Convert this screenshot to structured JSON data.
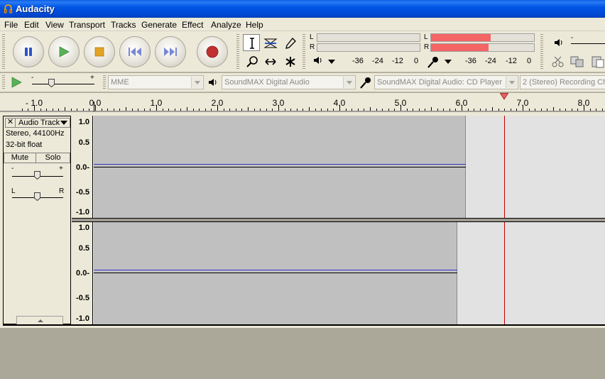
{
  "window": {
    "title": "Audacity"
  },
  "menu": [
    "File",
    "Edit",
    "View",
    "Transport",
    "Tracks",
    "Generate",
    "Effect",
    "Analyze",
    "Help"
  ],
  "meters": {
    "play_lr": [
      "L",
      "R"
    ],
    "scale_left": [
      "-36",
      "-24",
      "-12",
      "0"
    ],
    "scale_right": [
      "-36",
      "-24",
      "-12",
      "0"
    ],
    "record_level_L": 0.58,
    "record_level_R": 0.56
  },
  "device": {
    "host": "MME",
    "output": "SoundMAX Digital Audio",
    "input": "SoundMAX Digital Audio: CD Player",
    "channels": "2 (Stereo) Recording Ch"
  },
  "ruler": {
    "labels": [
      "- 1.0",
      "0.0",
      "1.0",
      "2.0",
      "3.0",
      "4.0",
      "5.0",
      "6.0",
      "7.0",
      "8.0"
    ]
  },
  "track": {
    "name": "Audio Track",
    "close_symbol": "✕",
    "format": "Stereo, 44100Hz",
    "bits": "32-bit float",
    "mute": "Mute",
    "solo": "Solo",
    "gain_minus": "-",
    "gain_plus": "+",
    "pan_left": "L",
    "pan_right": "R",
    "scale": [
      "1.0",
      "0.5",
      "0.0-",
      "-0.5",
      "-1.0"
    ]
  },
  "colors": {
    "meter_fill": "#f56565",
    "waveform": "#3232c8",
    "cursor": "#c80000",
    "titlebar": "#0055e5"
  }
}
